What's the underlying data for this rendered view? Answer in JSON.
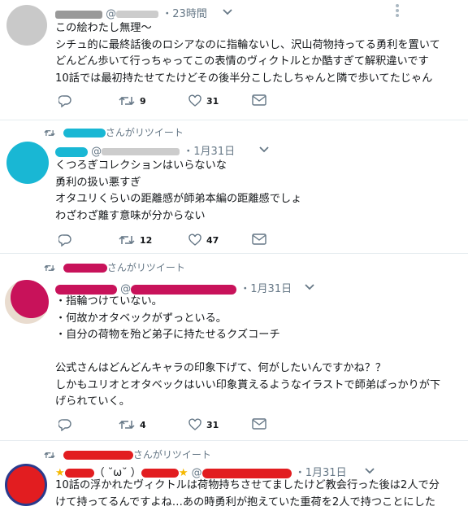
{
  "tweets": [
    {
      "handle_prefix": "@",
      "time": "・23時間",
      "lines": [
        "この絵わたし無理〜",
        "シチュ的に最終話後のロシアなのに指輪ないし、沢山荷物持ってる勇利を置いて",
        "どんどん歩いて行っちゃってこの表情のヴィクトルとか酷すぎて解釈違いです",
        "10話では最初持たせてたけどその後半分こしたしちゃんと隣で歩いてたじゃん"
      ],
      "retweets": "9",
      "likes": "31"
    },
    {
      "retweet_by": "さんがリツイート",
      "handle_prefix": "@",
      "time": "・1月31日",
      "lines": [
        "くつろぎコレクションはいらないな",
        "勇利の扱い悪すぎ",
        "オタユリくらいの距離感が師弟本編の距離感でしょ",
        "わざわざ離す意味が分からない"
      ],
      "retweets": "12",
      "likes": "47"
    },
    {
      "retweet_by": "さんがリツイート",
      "handle_prefix": "@",
      "time": "・1月31日",
      "lines": [
        "・指輪つけていない。",
        "・何故かオタベックがずっといる。",
        "・自分の荷物を殆ど弟子に持たせるクズコーチ",
        "",
        "公式さんはどんどんキャラの印象下げて、何がしたいんですかね？？",
        "しかもユリオとオタベックはいい印象貰えるようなイラストで師弟ばっかりが下",
        "げられていく。"
      ],
      "retweets": "4",
      "likes": "31"
    },
    {
      "retweet_by": "さんがリツイート",
      "name_prefix": "★",
      "name_mid": "（ ˘ω˘ ）",
      "name_suffix": "★",
      "handle_prefix": "@",
      "time": "・1月31日",
      "lines": [
        "10話の浮かれたヴィクトルは荷物持ちさせてましたけど教会行った後は2人で分",
        "けて持ってるんですよね…あの時勇利が抱えていた重荷を2人で持つことにした"
      ]
    }
  ],
  "colors": {
    "cyan_scribble": "#19b7d4",
    "magenta_scribble": "#c8125a",
    "red_scribble": "#e21d20",
    "icon_gray": "#657786"
  }
}
